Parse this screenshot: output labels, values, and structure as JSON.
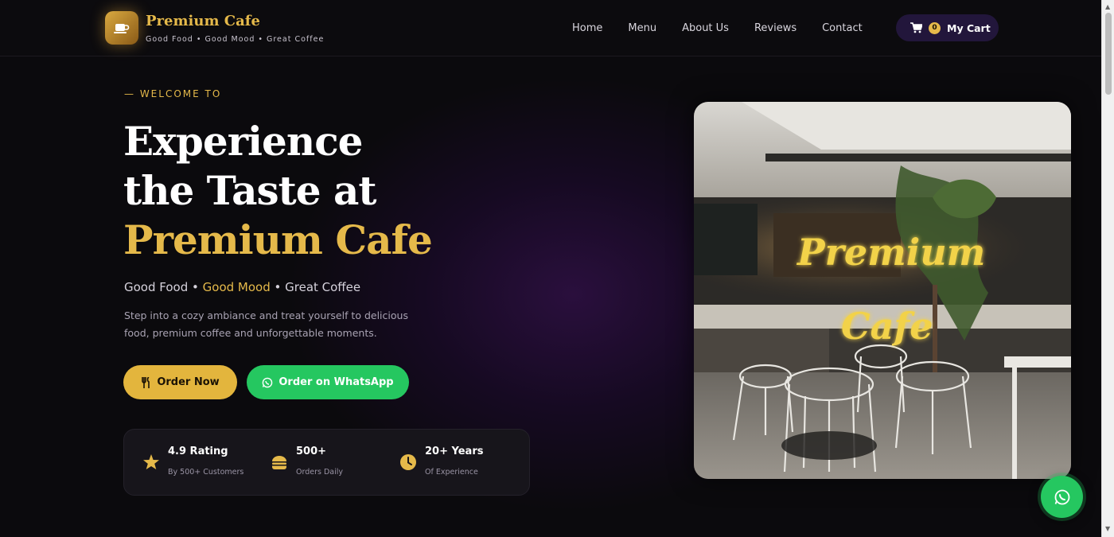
{
  "brand": {
    "name": "Premium Cafe",
    "tagline": "Good Food • Good Mood • Great Coffee",
    "logo_icon": "coffee-cup-icon"
  },
  "nav": {
    "items": [
      {
        "label": "Home"
      },
      {
        "label": "Menu"
      },
      {
        "label": "About Us"
      },
      {
        "label": "Reviews"
      },
      {
        "label": "Contact"
      }
    ],
    "cart": {
      "count": "0",
      "label": "My Cart",
      "icon": "cart-icon"
    }
  },
  "hero": {
    "eyebrow": "— WELCOME TO",
    "headline": {
      "line1": "Experience",
      "line2": "the Taste at",
      "line3": "Premium Cafe"
    },
    "tagline": {
      "part1": "Good Food",
      "sep1": " • ",
      "part2": "Good Mood",
      "sep2": " • ",
      "part3": "Great Coffee"
    },
    "description": "Step into a cozy ambiance and treat yourself to delicious food, premium coffee and unforgettable moments.",
    "buttons": {
      "order": {
        "label": "Order Now",
        "icon": "cutlery-icon"
      },
      "whatsapp": {
        "label": "Order on WhatsApp",
        "icon": "whatsapp-icon"
      }
    },
    "stats": [
      {
        "title": "4.9 Rating",
        "sub": "By 500+ Customers",
        "icon": "star-icon"
      },
      {
        "title": "500+",
        "sub": "Orders Daily",
        "icon": "burger-icon"
      },
      {
        "title": "20+ Years",
        "sub": "Of Experience",
        "icon": "clock-icon"
      }
    ],
    "photo": {
      "neon_line1": "Premium",
      "neon_line2": "Cafe"
    }
  },
  "colors": {
    "gold": "#e5b94a",
    "whatsapp_green": "#25c760",
    "background": "#0b0a0d",
    "cart_bg": "#22163b"
  }
}
